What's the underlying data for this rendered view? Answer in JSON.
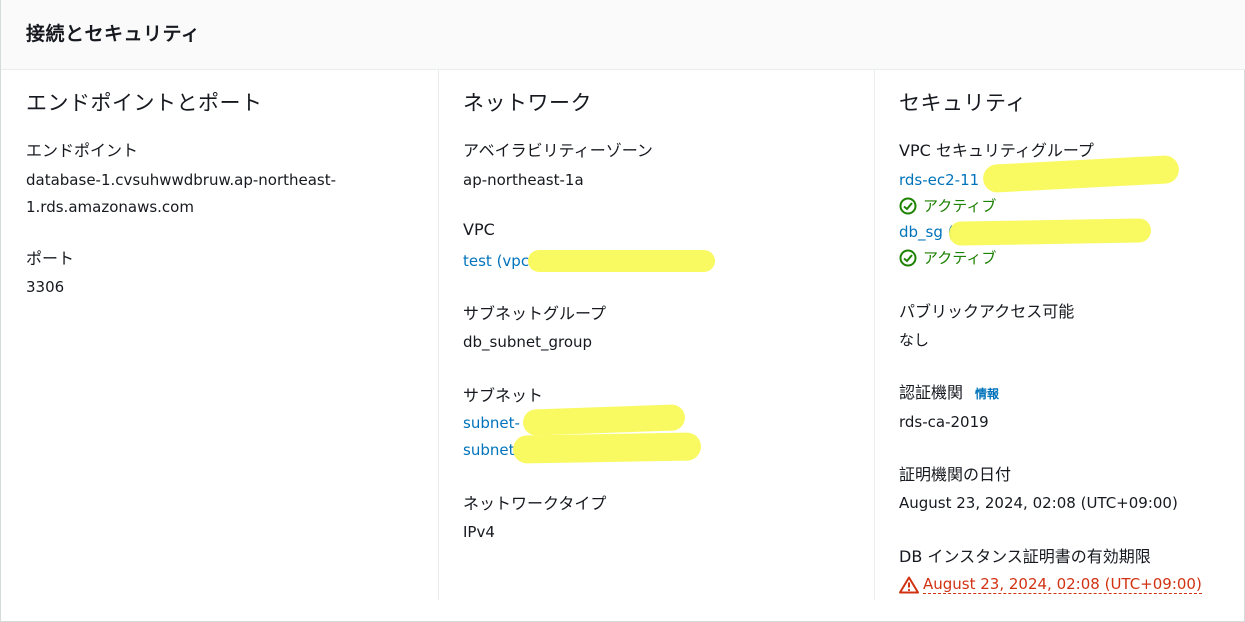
{
  "header": {
    "title": "接続とセキュリティ"
  },
  "endpoint_port": {
    "title": "エンドポイントとポート",
    "endpoint_label": "エンドポイント",
    "endpoint_value_line1": "database-1.cvsuhwwdbruw.ap-northeast-",
    "endpoint_value_line2": "1.rds.amazonaws.com",
    "port_label": "ポート",
    "port_value": "3306"
  },
  "network": {
    "title": "ネットワーク",
    "az_label": "アベイラビリティーゾーン",
    "az_value": "ap-northeast-1a",
    "vpc_label": "VPC",
    "vpc_value": "test (vpc",
    "subnet_group_label": "サブネットグループ",
    "subnet_group_value": "db_subnet_group",
    "subnet_label": "サブネット",
    "subnets": [
      "subnet-",
      "subnet"
    ],
    "network_type_label": "ネットワークタイプ",
    "network_type_value": "IPv4"
  },
  "security": {
    "title": "セキュリティ",
    "vpc_sg_label": "VPC セキュリティグループ",
    "security_groups": [
      {
        "name": "rds-ec2-11",
        "status": "アクティブ"
      },
      {
        "name": "db_sg (",
        "status": "アクティブ"
      }
    ],
    "public_access_label": "パブリックアクセス可能",
    "public_access_value": "なし",
    "ca_label": "認証機関",
    "ca_info_link": "情報",
    "ca_value": "rds-ca-2019",
    "ca_date_label": "証明機関の日付",
    "ca_date_value": "August 23, 2024, 02:08 (UTC+09:00)",
    "cert_expiry_label": "DB インスタンス証明書の有効期限",
    "cert_expiry_value": "August 23, 2024, 02:08 (UTC+09:00)"
  },
  "colors": {
    "link": "#0073bb",
    "success": "#1d8102",
    "warning": "#d13212",
    "redaction": "#f9f95a"
  }
}
